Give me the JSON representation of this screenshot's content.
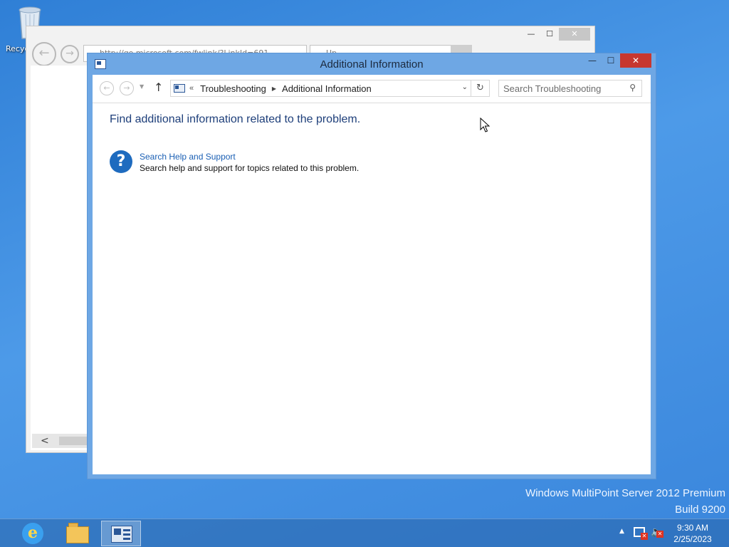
{
  "desktop": {
    "recycle_bin_label": "Recyc",
    "watermark_line1": "Windows MultiPoint Server 2012 Premium",
    "watermark_line2": "Build 9200"
  },
  "bg_window": {
    "address_text": "http://go.microsoft.com/fwlink/?LinkId=691",
    "tab_text": "Up"
  },
  "window": {
    "title": "Additional Information",
    "minimize_glyph": "—",
    "maximize_glyph": "☐",
    "close_glyph": "✕"
  },
  "navbar": {
    "breadcrumb_prefix": "«",
    "breadcrumb": [
      "Troubleshooting",
      "Additional Information"
    ],
    "search_placeholder": "Search Troubleshooting"
  },
  "content": {
    "heading": "Find additional information related to the problem.",
    "items": [
      {
        "link": "Search Help and Support",
        "description": "Search help and support for topics related to this problem.",
        "icon": "help-icon"
      }
    ]
  },
  "taskbar": {
    "apps": [
      "internet-explorer",
      "file-explorer",
      "control-panel"
    ],
    "clock_time": "9:30 AM",
    "clock_date": "2/25/2023"
  },
  "colors": {
    "desktop": "#3f8ee0",
    "window_frame": "#6ea7e4",
    "close_button": "#c7372f",
    "heading_text": "#1e3f7a",
    "link_text": "#1a5fb4"
  }
}
